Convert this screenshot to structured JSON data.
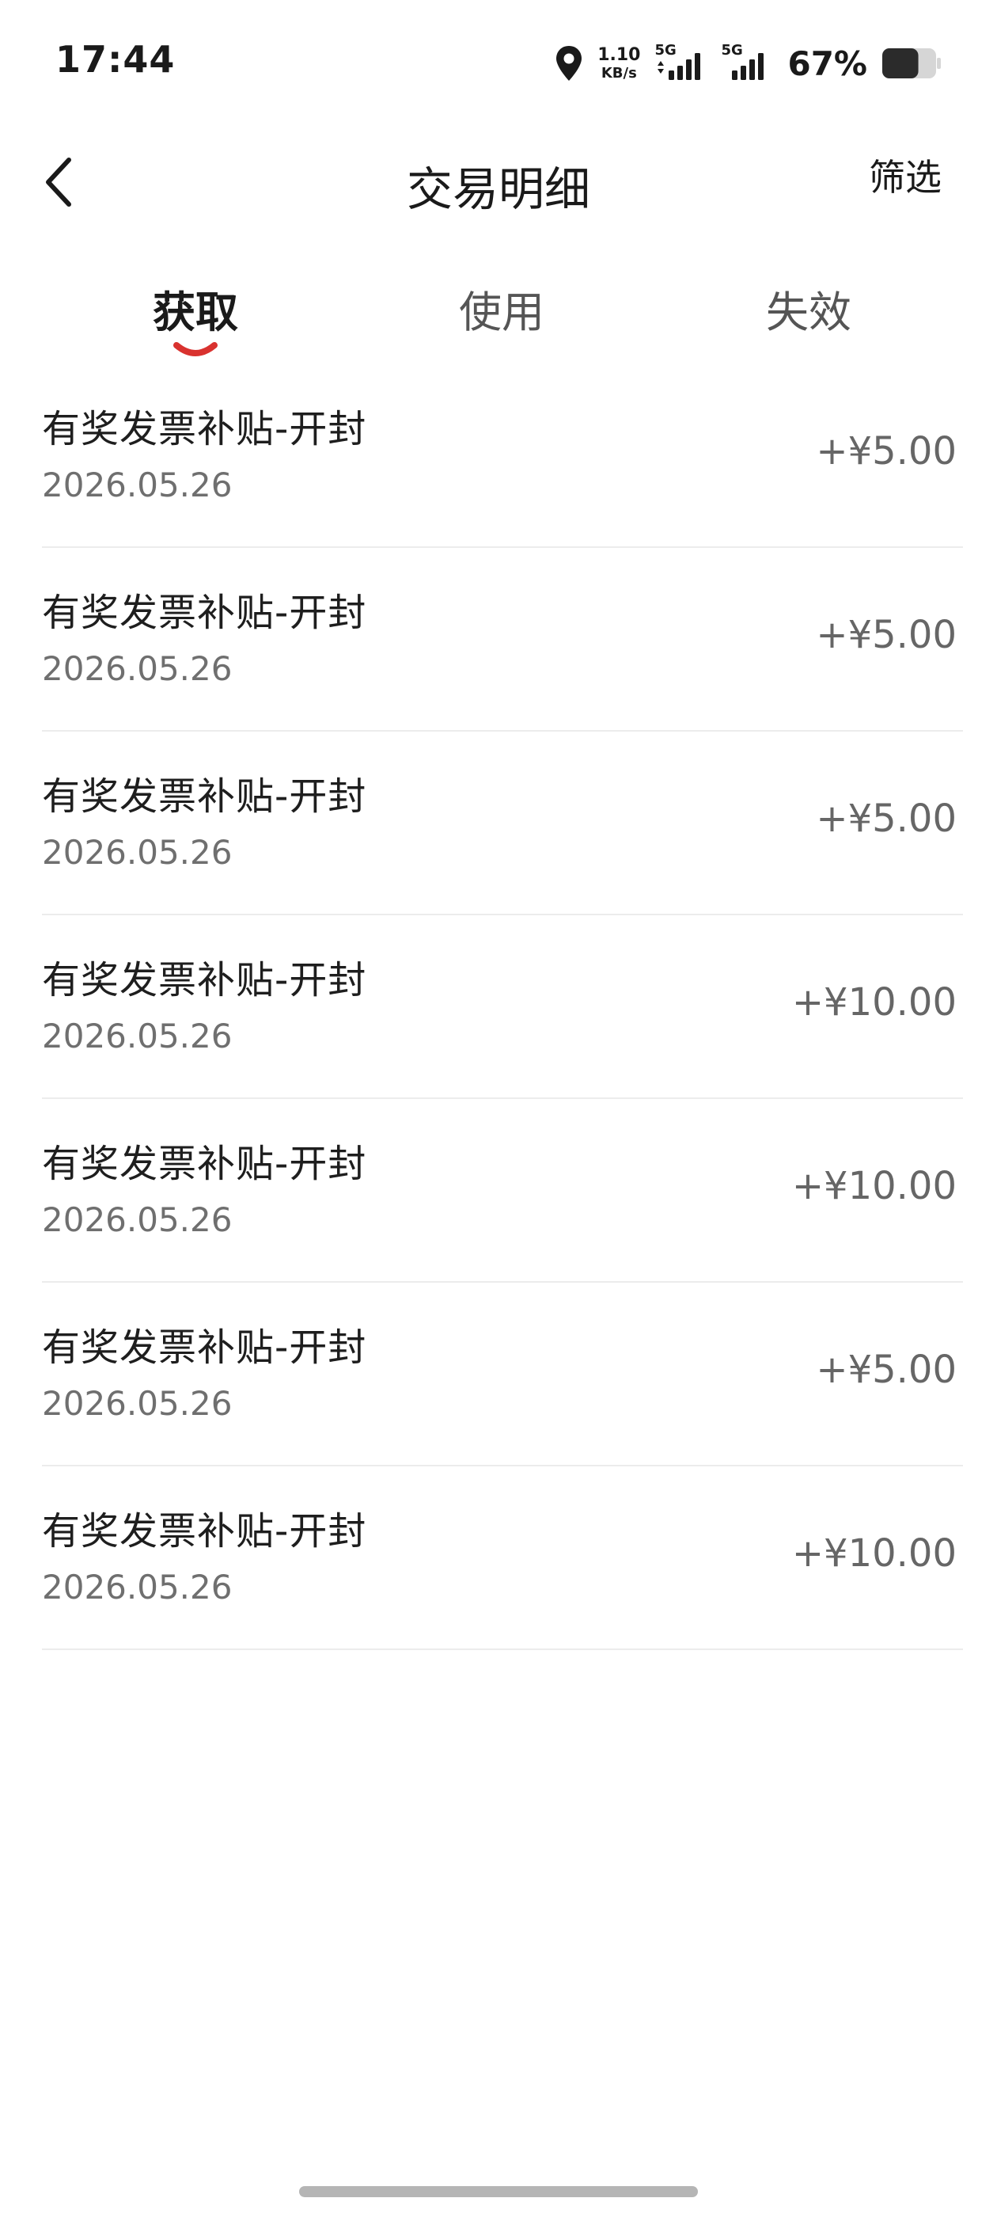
{
  "status_bar": {
    "time": "17:44",
    "net_speed_value": "1.10",
    "net_speed_unit": "KB/s",
    "sim1_label": "5G",
    "sim2_label": "5G",
    "battery_percent": "67%",
    "battery_level": 0.67,
    "icons": [
      "location-icon",
      "signal-icon",
      "battery-icon"
    ]
  },
  "header": {
    "title": "交易明细",
    "filter_label": "筛选",
    "back_icon": "chevron-left-icon"
  },
  "tabs": [
    {
      "label": "获取",
      "active": true
    },
    {
      "label": "使用",
      "active": false
    },
    {
      "label": "失效",
      "active": false
    }
  ],
  "colors": {
    "accent": "#d9322f",
    "text_primary": "#1e1e1e",
    "text_secondary": "#6f6f6f",
    "amount": "#666666",
    "divider": "#ececec"
  },
  "transactions": [
    {
      "title": "有奖发票补贴-开封",
      "date": "2026.05.26",
      "amount": "+¥5.00"
    },
    {
      "title": "有奖发票补贴-开封",
      "date": "2026.05.26",
      "amount": "+¥5.00"
    },
    {
      "title": "有奖发票补贴-开封",
      "date": "2026.05.26",
      "amount": "+¥5.00"
    },
    {
      "title": "有奖发票补贴-开封",
      "date": "2026.05.26",
      "amount": "+¥10.00"
    },
    {
      "title": "有奖发票补贴-开封",
      "date": "2026.05.26",
      "amount": "+¥10.00"
    },
    {
      "title": "有奖发票补贴-开封",
      "date": "2026.05.26",
      "amount": "+¥5.00"
    },
    {
      "title": "有奖发票补贴-开封",
      "date": "2026.05.26",
      "amount": "+¥10.00"
    }
  ]
}
